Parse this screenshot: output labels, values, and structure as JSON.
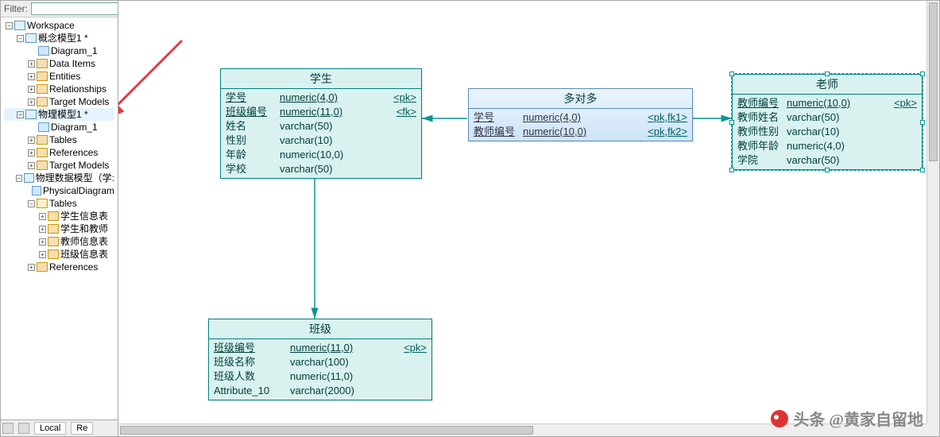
{
  "sidebar": {
    "filter_label": "Filter:",
    "filter_value": "",
    "nodes": [
      {
        "indent": 0,
        "exp": "minus",
        "icon": "model",
        "label": "Workspace"
      },
      {
        "indent": 1,
        "exp": "minus",
        "icon": "model",
        "label": "概念模型1 *"
      },
      {
        "indent": 2,
        "exp": "",
        "icon": "diagram",
        "label": "Diagram_1"
      },
      {
        "indent": 2,
        "exp": "plus",
        "icon": "folder",
        "label": "Data Items"
      },
      {
        "indent": 2,
        "exp": "plus",
        "icon": "folder",
        "label": "Entities"
      },
      {
        "indent": 2,
        "exp": "plus",
        "icon": "folder",
        "label": "Relationships"
      },
      {
        "indent": 2,
        "exp": "plus",
        "icon": "folder",
        "label": "Target Models"
      },
      {
        "indent": 1,
        "exp": "minus",
        "icon": "model",
        "label": "物理模型1 *",
        "sel": true
      },
      {
        "indent": 2,
        "exp": "",
        "icon": "diagram",
        "label": "Diagram_1"
      },
      {
        "indent": 2,
        "exp": "plus",
        "icon": "folder",
        "label": "Tables"
      },
      {
        "indent": 2,
        "exp": "plus",
        "icon": "folder",
        "label": "References"
      },
      {
        "indent": 2,
        "exp": "plus",
        "icon": "folder",
        "label": "Target Models"
      },
      {
        "indent": 1,
        "exp": "minus",
        "icon": "model",
        "label": "物理数据模型（学:"
      },
      {
        "indent": 2,
        "exp": "",
        "icon": "diagram",
        "label": "PhysicalDiagram"
      },
      {
        "indent": 2,
        "exp": "minus",
        "icon": "folder-open",
        "label": "Tables"
      },
      {
        "indent": 3,
        "exp": "plus",
        "icon": "folder",
        "label": "学生信息表"
      },
      {
        "indent": 3,
        "exp": "plus",
        "icon": "folder",
        "label": "学生和教师"
      },
      {
        "indent": 3,
        "exp": "plus",
        "icon": "folder",
        "label": "教师信息表"
      },
      {
        "indent": 3,
        "exp": "plus",
        "icon": "folder",
        "label": "班级信息表"
      },
      {
        "indent": 2,
        "exp": "plus",
        "icon": "folder",
        "label": "References"
      }
    ],
    "bottom_tab1": "Local",
    "bottom_tab2": "Re"
  },
  "entities": {
    "student": {
      "title": "学生",
      "rows": [
        {
          "name": "学号",
          "type": "numeric(4,0)",
          "key": "<pk>",
          "pk": true
        },
        {
          "name": "班级编号",
          "type": "numeric(11,0)",
          "key": "<fk>",
          "pk": true
        },
        {
          "name": "姓名",
          "type": "varchar(50)",
          "key": ""
        },
        {
          "name": "性别",
          "type": "varchar(10)",
          "key": ""
        },
        {
          "name": "年龄",
          "type": "numeric(10,0)",
          "key": ""
        },
        {
          "name": "学校",
          "type": "varchar(50)",
          "key": ""
        }
      ]
    },
    "assoc": {
      "title": "多对多",
      "rows": [
        {
          "name": "学号",
          "type": "numeric(4,0)",
          "key": "<pk,fk1>",
          "pk": true
        },
        {
          "name": "教师编号",
          "type": "numeric(10,0)",
          "key": "<pk,fk2>",
          "pk": true
        }
      ]
    },
    "teacher": {
      "title": "老师",
      "rows": [
        {
          "name": "教师编号",
          "type": "numeric(10,0)",
          "key": "<pk>",
          "pk": true
        },
        {
          "name": "教师姓名",
          "type": "varchar(50)",
          "key": ""
        },
        {
          "name": "教师性别",
          "type": "varchar(10)",
          "key": ""
        },
        {
          "name": "教师年龄",
          "type": "numeric(4,0)",
          "key": ""
        },
        {
          "name": "学院",
          "type": "varchar(50)",
          "key": ""
        }
      ]
    },
    "class": {
      "title": "班级",
      "rows": [
        {
          "name": "班级编号",
          "type": "numeric(11,0)",
          "key": "<pk>",
          "pk": true
        },
        {
          "name": "班级名称",
          "type": "varchar(100)",
          "key": ""
        },
        {
          "name": "班级人数",
          "type": "numeric(11,0)",
          "key": ""
        },
        {
          "name": "Attribute_10",
          "type": "varchar(2000)",
          "key": ""
        }
      ]
    }
  },
  "watermark": "头条 @黄家自留地"
}
